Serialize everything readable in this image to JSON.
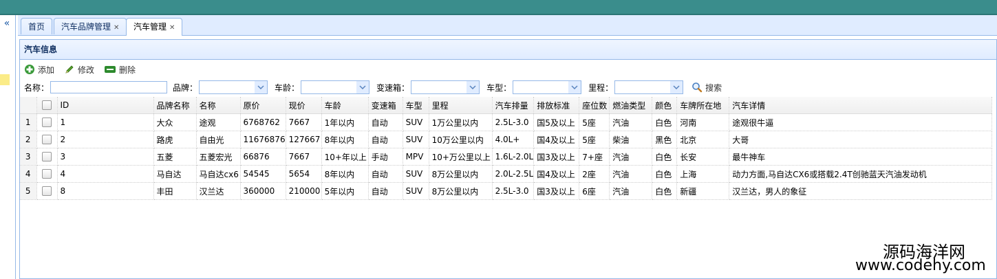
{
  "tabs": [
    {
      "label": "首页",
      "closable": false,
      "active": false
    },
    {
      "label": "汽车品牌管理",
      "closable": true,
      "active": false
    },
    {
      "label": "汽车管理",
      "closable": true,
      "active": true
    }
  ],
  "sidebar": {
    "collapse_glyph": "«"
  },
  "panel": {
    "title": "汽车信息"
  },
  "toolbar": {
    "add": "添加",
    "edit": "修改",
    "delete": "删除"
  },
  "search": {
    "name_label": "名称：",
    "brand_label": "品牌：",
    "age_label": "车龄：",
    "gearbox_label": "变速箱：",
    "type_label": "车型：",
    "mileage_label": "里程：",
    "search_button": "搜索"
  },
  "grid": {
    "columns": [
      "ID",
      "品牌名称",
      "名称",
      "原价",
      "现价",
      "车龄",
      "变速箱",
      "车型",
      "里程",
      "汽车排量",
      "排放标准",
      "座位数",
      "燃油类型",
      "颜色",
      "车牌所在地",
      "汽车详情"
    ],
    "rows": [
      {
        "rn": "1",
        "cells": [
          "1",
          "大众",
          "途观",
          "6768762",
          "7667",
          "1年以内",
          "自动",
          "SUV",
          "1万公里以内",
          "2.5L-3.0",
          "国5及以上",
          "5座",
          "汽油",
          "白色",
          "河南",
          "途观很牛逼"
        ]
      },
      {
        "rn": "2",
        "cells": [
          "2",
          "路虎",
          "自由光",
          "11676876",
          "127667",
          "8年以内",
          "自动",
          "SUV",
          "10万公里以内",
          "4.0L+",
          "国4及以上",
          "5座",
          "柴油",
          "黑色",
          "北京",
          "大哥"
        ]
      },
      {
        "rn": "3",
        "cells": [
          "3",
          "五菱",
          "五菱宏光",
          "66876",
          "7667",
          "10+年以上",
          "手动",
          "MPV",
          "10+万公里以上",
          "1.6L-2.0L",
          "国3及以上",
          "7+座",
          "汽油",
          "白色",
          "长安",
          "最牛神车"
        ]
      },
      {
        "rn": "4",
        "cells": [
          "4",
          "马自达",
          "马自达cx6",
          "54545",
          "5654",
          "8年以内",
          "自动",
          "SUV",
          "8万公里以内",
          "2.0L-2.5L",
          "国4及以上",
          "2座",
          "汽油",
          "白色",
          "上海",
          "动力方面,马自达CX6或搭载2.4T创驰蓝天汽油发动机"
        ]
      },
      {
        "rn": "5",
        "cells": [
          "8",
          "丰田",
          "汉兰达",
          "360000",
          "210000",
          "5年以内",
          "自动",
          "SUV",
          "8万公里以内",
          "2.5L-3.0",
          "国3及以上",
          "6座",
          "汽油",
          "白色",
          "新疆",
          "汉兰达，男人的象征"
        ]
      }
    ]
  },
  "watermark": {
    "line1": "源码海洋网",
    "line2": "www.codehy.com"
  },
  "colors": {
    "topbar": "#3a8d8c",
    "border": "#95b8e7",
    "header_bg": "#e0ecff",
    "highlight": "#fbec88"
  }
}
